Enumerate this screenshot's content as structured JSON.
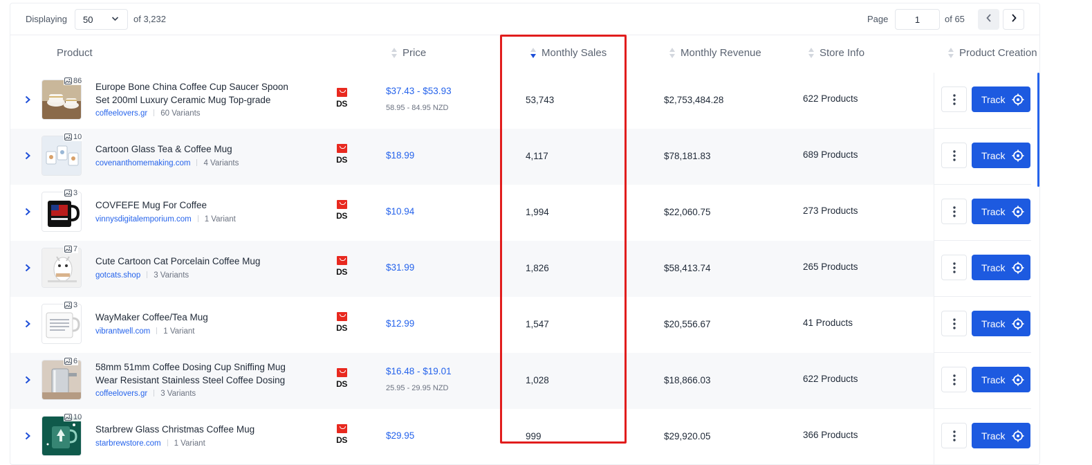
{
  "pagination": {
    "displaying_label": "Displaying",
    "per_page": "50",
    "of_total": "of 3,232",
    "page_label": "Page",
    "current_page": "1",
    "of_pages": "of 65"
  },
  "columns": {
    "product": "Product",
    "price": "Price",
    "monthly_sales": "Monthly Sales",
    "monthly_revenue": "Monthly Revenue",
    "store_info": "Store Info",
    "product_creation": "Product Creation"
  },
  "sort": {
    "column": "Monthly Sales",
    "direction": "descending"
  },
  "colors": {
    "accent": "#1d5ae0",
    "link": "#2563eb",
    "highlight": "#e11d1d",
    "row_alt": "#f7f8fa"
  },
  "action_labels": {
    "track": "Track",
    "ds_badge": "DS"
  },
  "rows": [
    {
      "image_count": "86",
      "title_1": "Europe Bone China Coffee Cup Saucer Spoon",
      "title_2": "Set 200ml Luxury Ceramic Mug Top-grade",
      "store": "coffeelovers.gr",
      "variants": "60 Variants",
      "price": "$37.43 - $53.93",
      "price_sub": "58.95 - 84.95 NZD",
      "monthly_sales": "53,743",
      "monthly_revenue": "$2,753,484.28",
      "store_info": "622 Products",
      "thumb": "cups"
    },
    {
      "image_count": "10",
      "title_1": "Cartoon Glass Tea & Coffee Mug",
      "title_2": "",
      "store": "covenanthomemaking.com",
      "variants": "4 Variants",
      "price": "$18.99",
      "price_sub": "",
      "monthly_sales": "4,117",
      "monthly_revenue": "$78,181.83",
      "store_info": "689 Products",
      "thumb": "glass"
    },
    {
      "image_count": "3",
      "title_1": "COVFEFE Mug For Coffee",
      "title_2": "",
      "store": "vinnysdigitalemporium.com",
      "variants": "1 Variant",
      "price": "$10.94",
      "price_sub": "",
      "monthly_sales": "1,994",
      "monthly_revenue": "$22,060.75",
      "store_info": "273 Products",
      "thumb": "black"
    },
    {
      "image_count": "7",
      "title_1": "Cute Cartoon Cat Porcelain Coffee Mug",
      "title_2": "",
      "store": "gotcats.shop",
      "variants": "3 Variants",
      "price": "$31.99",
      "price_sub": "",
      "monthly_sales": "1,826",
      "monthly_revenue": "$58,413.74",
      "store_info": "265 Products",
      "thumb": "cat"
    },
    {
      "image_count": "3",
      "title_1": "WayMaker Coffee/Tea Mug",
      "title_2": "",
      "store": "vibrantwell.com",
      "variants": "1 Variant",
      "price": "$12.99",
      "price_sub": "",
      "monthly_sales": "1,547",
      "monthly_revenue": "$20,556.67",
      "store_info": "41 Products",
      "thumb": "white"
    },
    {
      "image_count": "6",
      "title_1": "58mm 51mm Coffee Dosing Cup Sniffing Mug",
      "title_2": "Wear Resistant Stainless Steel Coffee Dosing",
      "store": "coffeelovers.gr",
      "variants": "3 Variants",
      "price": "$16.48 - $19.01",
      "price_sub": "25.95 - 29.95 NZD",
      "monthly_sales": "1,028",
      "monthly_revenue": "$18,866.03",
      "store_info": "622 Products",
      "thumb": "steel"
    },
    {
      "image_count": "10",
      "title_1": "Starbrew Glass Christmas Coffee Mug",
      "title_2": "",
      "store": "starbrewstore.com",
      "variants": "1 Variant",
      "price": "$29.95",
      "price_sub": "",
      "monthly_sales": "999",
      "monthly_revenue": "$29,920.05",
      "store_info": "366 Products",
      "thumb": "green"
    }
  ]
}
